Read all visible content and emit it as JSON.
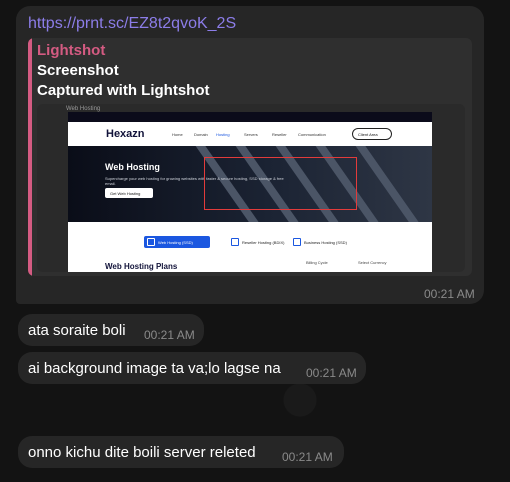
{
  "link_message": {
    "url": "https://prnt.sc/EZ8t2qvoK_2S",
    "preview": {
      "site_name": "Lightshot",
      "title": "Screenshot",
      "description": "Captured with Lightshot"
    },
    "time": "00:21 AM",
    "shot": {
      "caption": "Web Hosting",
      "logo": "Hexazn",
      "nav_links": [
        "Home",
        "Domain",
        "Hosting",
        "Servers",
        "Reseller",
        "Communication"
      ],
      "client_button": "Client Area",
      "hero_title": "Web Hosting",
      "hero_subtitle": "Supercharge your web hosting for growing websites with faster & secure hosting, SSD storage & free email.",
      "hero_button": "Get Web Hosting",
      "tabs": [
        "Web Hosting (SSD)",
        "Reseller Hosting (BDIX)",
        "Business Hosting (SSD)"
      ],
      "plans_title": "Web Hosting Plans",
      "billing_label": "Billing Cycle",
      "currency_label": "Select Currency",
      "accent": "#1b57e0",
      "highlight_color": "#e23b3b"
    }
  },
  "messages": [
    {
      "text": "ata soraite boli",
      "time": "00:21 AM"
    },
    {
      "text": "ai background image ta va;lo lagse na",
      "time": "00:21 AM"
    },
    {
      "text": "onno kichu dite boili server releted",
      "time": "00:21 AM"
    }
  ],
  "colors": {
    "link": "#8c7de8",
    "preview_accent": "#d45b82",
    "bubble": "#262626"
  }
}
